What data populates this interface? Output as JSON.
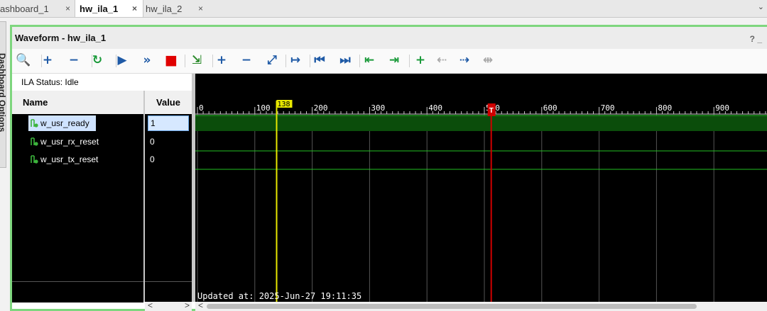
{
  "tabs": [
    {
      "label": "ashboard_1",
      "close": "×"
    },
    {
      "label": "hw_ila_1",
      "close": "×"
    },
    {
      "label": "hw_ila_2",
      "close": "×"
    }
  ],
  "side_tab": "Dashboard Options",
  "panel": {
    "title": "Waveform - hw_ila_1",
    "corner": "? _"
  },
  "toolbar": [
    {
      "name": "zoom-search-icon",
      "glyph": "🔍"
    },
    {
      "name": "add-icon",
      "glyph": "+"
    },
    {
      "name": "remove-icon",
      "glyph": "−"
    },
    {
      "name": "run-trigger-immediate-icon",
      "glyph": "↻"
    },
    {
      "name": "run-trigger-icon",
      "glyph": "▶"
    },
    {
      "name": "run-trigger-continuous-icon",
      "glyph": "»"
    },
    {
      "name": "stop-trigger-icon",
      "glyph": "■"
    },
    {
      "name": "export-icon",
      "glyph": "⇲"
    },
    {
      "name": "zoom-in-icon",
      "glyph": "+"
    },
    {
      "name": "zoom-out-icon",
      "glyph": "−"
    },
    {
      "name": "zoom-fit-icon",
      "glyph": "⤢"
    },
    {
      "name": "go-to-cursor-icon",
      "glyph": "↦"
    },
    {
      "name": "go-to-start-icon",
      "glyph": "⏮"
    },
    {
      "name": "go-to-end-icon",
      "glyph": "⏭"
    },
    {
      "name": "previous-transition-icon",
      "glyph": "⇤"
    },
    {
      "name": "next-transition-icon",
      "glyph": "⇥"
    },
    {
      "name": "add-marker-icon",
      "glyph": "+"
    },
    {
      "name": "previous-marker-icon",
      "glyph": "⇠"
    },
    {
      "name": "next-marker-icon",
      "glyph": "⇢"
    },
    {
      "name": "swap-cursors-icon",
      "glyph": "⇹"
    }
  ],
  "ila_status": "ILA Status:  Idle",
  "columns": {
    "name": "Name",
    "value": "Value"
  },
  "signals": [
    {
      "name": "w_usr_ready",
      "value": "1",
      "selected": true
    },
    {
      "name": "w_usr_rx_reset",
      "value": "0",
      "selected": false
    },
    {
      "name": "w_usr_tx_reset",
      "value": "0",
      "selected": false
    }
  ],
  "waveform": {
    "axis_min": 0,
    "axis_max": 1000,
    "tick_labels": [
      "0",
      "100",
      "200",
      "300",
      "400",
      "500",
      "600",
      "700",
      "800",
      "900"
    ],
    "cursor_value": 138,
    "cursor_label": "138",
    "trigger_value": 512,
    "trigger_label": "T",
    "updated": "Updated at: 2025-Jun-27 19:11:35",
    "colors": {
      "bus": "#0b4d0b",
      "line": "#22c022",
      "cursor": "#e8e800",
      "trigger": "#d00000",
      "grid": "#555555"
    }
  },
  "scroll_arrows": {
    "left": "<",
    "right": ">"
  }
}
